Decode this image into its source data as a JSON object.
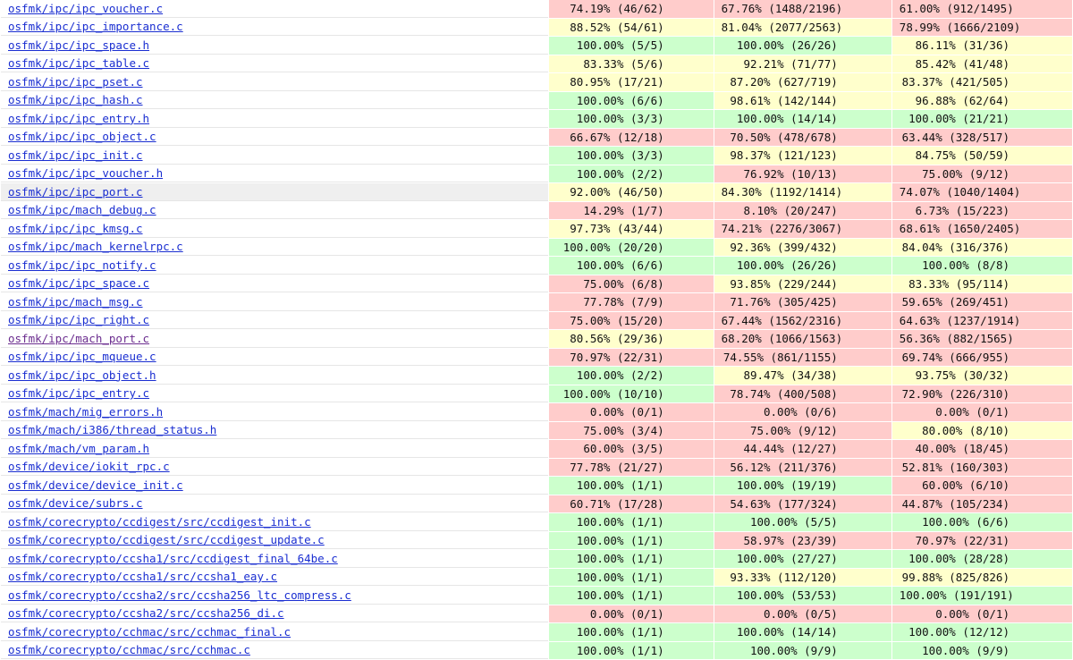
{
  "colors": {
    "low": "#ffcccb",
    "medium": "#ffffcc",
    "high": "#ccffcc",
    "link": "#1a2ed1",
    "visited_link": "#6b2d8f"
  },
  "rows": [
    {
      "file": "osfmk/ipc/ipc_voucher.c",
      "fn": "74.19% (46/62)",
      "fn_l": "lo",
      "ln": "67.76% (1488/2196)",
      "ln_l": "lo",
      "br": "61.00% (912/1495)",
      "br_l": "lo"
    },
    {
      "file": "osfmk/ipc/ipc_importance.c",
      "fn": "88.52% (54/61)",
      "fn_l": "med",
      "ln": "81.04% (2077/2563)",
      "ln_l": "med",
      "br": "78.99% (1666/2109)",
      "br_l": "lo"
    },
    {
      "file": "osfmk/ipc/ipc_space.h",
      "fn": "100.00% (5/5)",
      "fn_l": "hi",
      "ln": "100.00% (26/26)",
      "ln_l": "hi",
      "br": "86.11% (31/36)",
      "br_l": "med"
    },
    {
      "file": "osfmk/ipc/ipc_table.c",
      "fn": "83.33% (5/6)",
      "fn_l": "med",
      "ln": "92.21% (71/77)",
      "ln_l": "med",
      "br": "85.42% (41/48)",
      "br_l": "med"
    },
    {
      "file": "osfmk/ipc/ipc_pset.c",
      "fn": "80.95% (17/21)",
      "fn_l": "med",
      "ln": "87.20% (627/719)",
      "ln_l": "med",
      "br": "83.37% (421/505)",
      "br_l": "med"
    },
    {
      "file": "osfmk/ipc/ipc_hash.c",
      "fn": "100.00% (6/6)",
      "fn_l": "hi",
      "ln": "98.61% (142/144)",
      "ln_l": "med",
      "br": "96.88% (62/64)",
      "br_l": "med"
    },
    {
      "file": "osfmk/ipc/ipc_entry.h",
      "fn": "100.00% (3/3)",
      "fn_l": "hi",
      "ln": "100.00% (14/14)",
      "ln_l": "hi",
      "br": "100.00% (21/21)",
      "br_l": "hi"
    },
    {
      "file": "osfmk/ipc/ipc_object.c",
      "fn": "66.67% (12/18)",
      "fn_l": "lo",
      "ln": "70.50% (478/678)",
      "ln_l": "lo",
      "br": "63.44% (328/517)",
      "br_l": "lo"
    },
    {
      "file": "osfmk/ipc/ipc_init.c",
      "fn": "100.00% (3/3)",
      "fn_l": "hi",
      "ln": "98.37% (121/123)",
      "ln_l": "med",
      "br": "84.75% (50/59)",
      "br_l": "med"
    },
    {
      "file": "osfmk/ipc/ipc_voucher.h",
      "fn": "100.00% (2/2)",
      "fn_l": "hi",
      "ln": "76.92% (10/13)",
      "ln_l": "lo",
      "br": "75.00% (9/12)",
      "br_l": "lo"
    },
    {
      "file": "osfmk/ipc/ipc_port.c",
      "fn": "92.00% (46/50)",
      "fn_l": "med",
      "ln": "84.30% (1192/1414)",
      "ln_l": "med",
      "br": "74.07% (1040/1404)",
      "br_l": "lo",
      "hl": true
    },
    {
      "file": "osfmk/ipc/mach_debug.c",
      "fn": "14.29% (1/7)",
      "fn_l": "lo",
      "ln": "8.10% (20/247)",
      "ln_l": "lo",
      "br": "6.73% (15/223)",
      "br_l": "lo"
    },
    {
      "file": "osfmk/ipc/ipc_kmsg.c",
      "fn": "97.73% (43/44)",
      "fn_l": "med",
      "ln": "74.21% (2276/3067)",
      "ln_l": "lo",
      "br": "68.61% (1650/2405)",
      "br_l": "lo"
    },
    {
      "file": "osfmk/ipc/mach_kernelrpc.c",
      "fn": "100.00% (20/20)",
      "fn_l": "hi",
      "ln": "92.36% (399/432)",
      "ln_l": "med",
      "br": "84.04% (316/376)",
      "br_l": "med"
    },
    {
      "file": "osfmk/ipc/ipc_notify.c",
      "fn": "100.00% (6/6)",
      "fn_l": "hi",
      "ln": "100.00% (26/26)",
      "ln_l": "hi",
      "br": "100.00% (8/8)",
      "br_l": "hi"
    },
    {
      "file": "osfmk/ipc/ipc_space.c",
      "fn": "75.00% (6/8)",
      "fn_l": "lo",
      "ln": "93.85% (229/244)",
      "ln_l": "med",
      "br": "83.33% (95/114)",
      "br_l": "med"
    },
    {
      "file": "osfmk/ipc/mach_msg.c",
      "fn": "77.78% (7/9)",
      "fn_l": "lo",
      "ln": "71.76% (305/425)",
      "ln_l": "lo",
      "br": "59.65% (269/451)",
      "br_l": "lo"
    },
    {
      "file": "osfmk/ipc/ipc_right.c",
      "fn": "75.00% (15/20)",
      "fn_l": "lo",
      "ln": "67.44% (1562/2316)",
      "ln_l": "lo",
      "br": "64.63% (1237/1914)",
      "br_l": "lo"
    },
    {
      "file": "osfmk/ipc/mach_port.c",
      "fn": "80.56% (29/36)",
      "fn_l": "med",
      "ln": "68.20% (1066/1563)",
      "ln_l": "lo",
      "br": "56.36% (882/1565)",
      "br_l": "lo",
      "visited": true
    },
    {
      "file": "osfmk/ipc/ipc_mqueue.c",
      "fn": "70.97% (22/31)",
      "fn_l": "lo",
      "ln": "74.55% (861/1155)",
      "ln_l": "lo",
      "br": "69.74% (666/955)",
      "br_l": "lo"
    },
    {
      "file": "osfmk/ipc/ipc_object.h",
      "fn": "100.00% (2/2)",
      "fn_l": "hi",
      "ln": "89.47% (34/38)",
      "ln_l": "med",
      "br": "93.75% (30/32)",
      "br_l": "med"
    },
    {
      "file": "osfmk/ipc/ipc_entry.c",
      "fn": "100.00% (10/10)",
      "fn_l": "hi",
      "ln": "78.74% (400/508)",
      "ln_l": "lo",
      "br": "72.90% (226/310)",
      "br_l": "lo"
    },
    {
      "file": "osfmk/mach/mig_errors.h",
      "fn": "0.00% (0/1)",
      "fn_l": "lo",
      "ln": "0.00% (0/6)",
      "ln_l": "lo",
      "br": "0.00% (0/1)",
      "br_l": "lo"
    },
    {
      "file": "osfmk/mach/i386/thread_status.h",
      "fn": "75.00% (3/4)",
      "fn_l": "lo",
      "ln": "75.00% (9/12)",
      "ln_l": "lo",
      "br": "80.00% (8/10)",
      "br_l": "med"
    },
    {
      "file": "osfmk/mach/vm_param.h",
      "fn": "60.00% (3/5)",
      "fn_l": "lo",
      "ln": "44.44% (12/27)",
      "ln_l": "lo",
      "br": "40.00% (18/45)",
      "br_l": "lo"
    },
    {
      "file": "osfmk/device/iokit_rpc.c",
      "fn": "77.78% (21/27)",
      "fn_l": "lo",
      "ln": "56.12% (211/376)",
      "ln_l": "lo",
      "br": "52.81% (160/303)",
      "br_l": "lo"
    },
    {
      "file": "osfmk/device/device_init.c",
      "fn": "100.00% (1/1)",
      "fn_l": "hi",
      "ln": "100.00% (19/19)",
      "ln_l": "hi",
      "br": "60.00% (6/10)",
      "br_l": "lo"
    },
    {
      "file": "osfmk/device/subrs.c",
      "fn": "60.71% (17/28)",
      "fn_l": "lo",
      "ln": "54.63% (177/324)",
      "ln_l": "lo",
      "br": "44.87% (105/234)",
      "br_l": "lo"
    },
    {
      "file": "osfmk/corecrypto/ccdigest/src/ccdigest_init.c",
      "fn": "100.00% (1/1)",
      "fn_l": "hi",
      "ln": "100.00% (5/5)",
      "ln_l": "hi",
      "br": "100.00% (6/6)",
      "br_l": "hi"
    },
    {
      "file": "osfmk/corecrypto/ccdigest/src/ccdigest_update.c",
      "fn": "100.00% (1/1)",
      "fn_l": "hi",
      "ln": "58.97% (23/39)",
      "ln_l": "lo",
      "br": "70.97% (22/31)",
      "br_l": "lo"
    },
    {
      "file": "osfmk/corecrypto/ccsha1/src/ccdigest_final_64be.c",
      "fn": "100.00% (1/1)",
      "fn_l": "hi",
      "ln": "100.00% (27/27)",
      "ln_l": "hi",
      "br": "100.00% (28/28)",
      "br_l": "hi"
    },
    {
      "file": "osfmk/corecrypto/ccsha1/src/ccsha1_eay.c",
      "fn": "100.00% (1/1)",
      "fn_l": "hi",
      "ln": "93.33% (112/120)",
      "ln_l": "med",
      "br": "99.88% (825/826)",
      "br_l": "med"
    },
    {
      "file": "osfmk/corecrypto/ccsha2/src/ccsha256_ltc_compress.c",
      "fn": "100.00% (1/1)",
      "fn_l": "hi",
      "ln": "100.00% (53/53)",
      "ln_l": "hi",
      "br": "100.00% (191/191)",
      "br_l": "hi"
    },
    {
      "file": "osfmk/corecrypto/ccsha2/src/ccsha256_di.c",
      "fn": "0.00% (0/1)",
      "fn_l": "lo",
      "ln": "0.00% (0/5)",
      "ln_l": "lo",
      "br": "0.00% (0/1)",
      "br_l": "lo"
    },
    {
      "file": "osfmk/corecrypto/cchmac/src/cchmac_final.c",
      "fn": "100.00% (1/1)",
      "fn_l": "hi",
      "ln": "100.00% (14/14)",
      "ln_l": "hi",
      "br": "100.00% (12/12)",
      "br_l": "hi"
    },
    {
      "file": "osfmk/corecrypto/cchmac/src/cchmac.c",
      "fn": "100.00% (1/1)",
      "fn_l": "hi",
      "ln": "100.00% (9/9)",
      "ln_l": "hi",
      "br": "100.00% (9/9)",
      "br_l": "hi"
    }
  ]
}
